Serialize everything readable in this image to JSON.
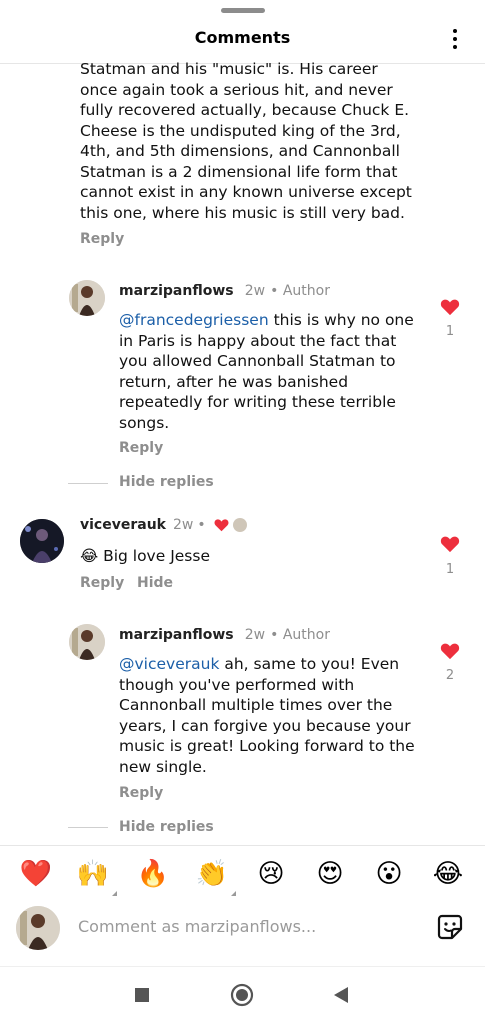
{
  "header": {
    "title": "Comments"
  },
  "top_comment": {
    "lines": [
      "Statman and his \"music\" is. His career",
      "once again took a serious hit, and never",
      "fully recovered actually, because Chuck E.",
      "Cheese is the undisputed king of the 3rd,",
      "4th, and 5th dimensions, and Cannonball",
      "Statman is a 2 dimensional life form that",
      "cannot exist in any known universe except",
      "this one, where his music is still very bad."
    ],
    "reply_label": "Reply"
  },
  "reply1": {
    "username": "marzipanflows",
    "time": "2w",
    "author_label": "Author",
    "mention": "@francedegriessen",
    "lines": [
      "this is why no one",
      "in Paris is happy about the fact that",
      "you allowed Cannonball Statman to",
      "return, after he was banished",
      "repeatedly for writing these terrible",
      "songs."
    ],
    "reply_label": "Reply",
    "likes": "1",
    "hide_replies": "Hide replies"
  },
  "comment2": {
    "username": "viceverauk",
    "time": "2w",
    "emoji": "😂",
    "text": "Big love Jesse",
    "reply_label": "Reply",
    "hide_label": "Hide",
    "likes": "1"
  },
  "reply2": {
    "username": "marzipanflows",
    "time": "2w",
    "author_label": "Author",
    "mention": "@viceverauk",
    "lines": [
      "ah, same to you! Even",
      "though you've performed with",
      "Cannonball multiple times over the",
      "years, I can forgive you because your",
      "music is great! Looking forward to the",
      "new single."
    ],
    "reply_label": "Reply",
    "likes": "2",
    "hide_replies": "Hide replies"
  },
  "reactions": [
    "❤️",
    "🙌",
    "🔥",
    "👏",
    "😢",
    "😍",
    "😮",
    "😂"
  ],
  "composer": {
    "placeholder": "Comment as marzipanflows..."
  },
  "colors": {
    "heart": "#ed2f3d",
    "mention": "#1c5fa8",
    "muted": "#8e8e8e"
  },
  "icons": {
    "more": "more-vertical-icon",
    "heart": "heart-icon",
    "sticker": "sticker-icon",
    "nav_square": "recents-icon",
    "nav_circle": "home-icon",
    "nav_triangle": "back-icon"
  }
}
